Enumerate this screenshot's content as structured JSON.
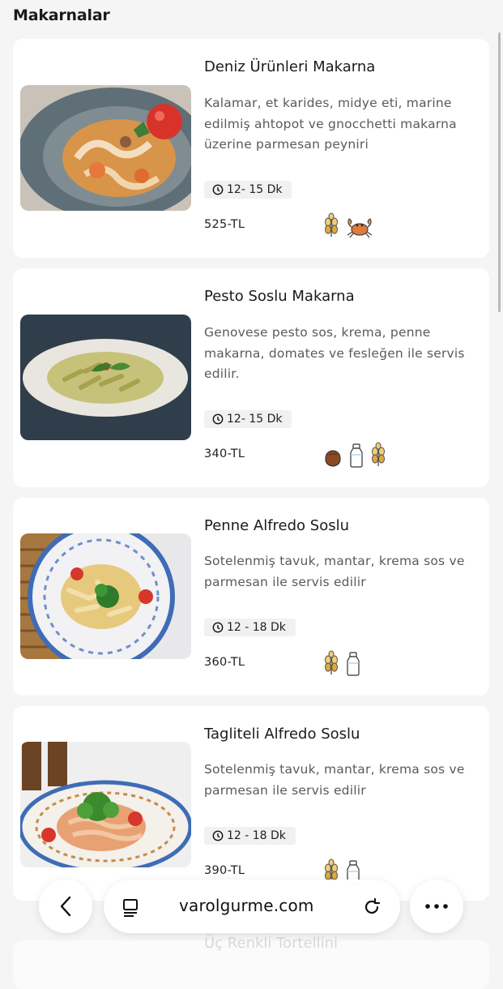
{
  "section_title": "Makarnalar",
  "products": [
    {
      "name": "Deniz Ürünleri Makarna",
      "description": "Kalamar, et karides, midye eti, marine edilmiş ahtopot ve gnocchetti makarna üzerine parmesan peyniri",
      "time": "12- 15 Dk",
      "price": "525-TL",
      "allergens": [
        "wheat-icon",
        "crab-icon"
      ]
    },
    {
      "name": "Pesto Soslu Makarna",
      "description": "Genovese pesto sos, krema, penne makarna, domates ve fesleğen ile servis edilir.",
      "time": "12- 15 Dk",
      "price": "340-TL",
      "allergens": [
        "nut-icon",
        "milk-icon",
        "wheat-icon"
      ]
    },
    {
      "name": "Penne Alfredo Soslu",
      "description": "Sotelenmiş tavuk, mantar, krema sos ve parmesan ile servis edilir",
      "time": "12 - 18 Dk",
      "price": "360-TL",
      "allergens": [
        "wheat-icon",
        "milk-icon"
      ]
    },
    {
      "name": "Tagliteli Alfredo Soslu",
      "description": "Sotelenmiş tavuk, mantar, krema sos ve parmesan ile servis edilir",
      "time": "12 - 18 Dk",
      "price": "390-TL",
      "allergens": [
        "wheat-icon",
        "milk-icon"
      ]
    }
  ],
  "next_product_name": "Üç Renkli Tortellini",
  "browser": {
    "url": "varolgurme.com",
    "back_icon": "chevron-left-icon",
    "tabs_icon": "tabs-icon",
    "reload_icon": "reload-icon",
    "more_icon": "more-icon"
  },
  "colors": {
    "background": "#f5f5f5",
    "card": "#ffffff",
    "wheat": "#e0a93a",
    "crab": "#e07b3c"
  }
}
